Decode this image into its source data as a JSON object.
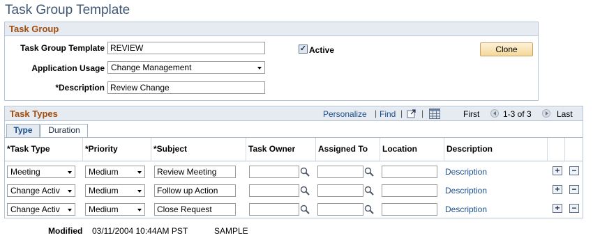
{
  "page": {
    "title": "Task Group Template"
  },
  "task_group": {
    "header": "Task Group",
    "template_label": "Task Group Template",
    "template_value": "REVIEW",
    "active_label": "Active",
    "active_checked": true,
    "clone_label": "Clone",
    "usage_label": "Application Usage",
    "usage_value": "Change Management",
    "description_label": "*Description",
    "description_value": "Review Change"
  },
  "grid": {
    "title": "Task Types",
    "personalize": "Personalize",
    "find": "Find",
    "first": "First",
    "count": "1-3 of 3",
    "last": "Last",
    "tabs": [
      {
        "label": "Type"
      },
      {
        "label": "Duration"
      }
    ],
    "columns": [
      "*Task Type",
      "*Priority",
      "*Subject",
      "Task Owner",
      "Assigned To",
      "Location",
      "Description"
    ],
    "rows": [
      {
        "task_type": "Meeting",
        "priority": "Medium",
        "subject": "Review Meeting",
        "task_owner": "",
        "assigned_to": "",
        "location": "",
        "description": "Description"
      },
      {
        "task_type": "Change Activ",
        "priority": "Medium",
        "subject": "Follow up Action",
        "task_owner": "",
        "assigned_to": "",
        "location": "",
        "description": "Description"
      },
      {
        "task_type": "Change Activ",
        "priority": "Medium",
        "subject": "Close Request",
        "task_owner": "",
        "assigned_to": "",
        "location": "",
        "description": "Description"
      }
    ],
    "add_symbol": "+",
    "delete_symbol": "−"
  },
  "footer": {
    "modified_label": "Modified",
    "modified_value": "03/11/2004 10:44AM PST",
    "user": "SAMPLE"
  },
  "icons": {
    "lookup": "magnifier-icon",
    "grid_view": "grid-view-icon",
    "view_all": "zoom-window-icon"
  },
  "colors": {
    "accent_header": "#a34c0b",
    "link": "#1a4e8c",
    "title": "#3d5572"
  }
}
